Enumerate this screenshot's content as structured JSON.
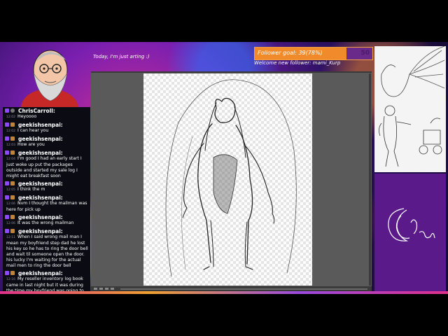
{
  "overlay": {
    "top_caption": "Today, I'm just arting :)",
    "follower_goal": "Follower goal: 39(78%)",
    "follower_goal_number": "50",
    "follower_goal_progress": 0.78,
    "welcome": "Welcome new follower: mami_Kurp"
  },
  "chat": {
    "messages": [
      {
        "user": "ChrisCarroll:",
        "time": "12:02",
        "text": "Heyoooo",
        "badges": [
          "twitch-icon",
          "mod-icon"
        ]
      },
      {
        "user": "geekishsenpai:",
        "time": "12:02",
        "text": "I can hear you",
        "badges": [
          "twitch-icon",
          "sub-icon"
        ]
      },
      {
        "user": "geekishsenpai:",
        "time": "12:03",
        "text": "How are you",
        "badges": [
          "twitch-icon",
          "sub-icon"
        ]
      },
      {
        "user": "geekishsenpai:",
        "time": "12:04",
        "text": "I'm good I had an early start I just woke up put the packages outside and started my sale log I might eat breakfast soon",
        "badges": [
          "twitch-icon",
          "sub-icon"
        ]
      },
      {
        "user": "geekishsenpai:",
        "time": "12:05",
        "text": "I think the m",
        "badges": [
          "twitch-icon",
          "sub-icon"
        ]
      },
      {
        "user": "geekishsenpai:",
        "time": "12:06",
        "text": "Nvm I thought the mailman was here for pick up",
        "badges": [
          "twitch-icon",
          "sub-icon"
        ]
      },
      {
        "user": "geekishsenpai:",
        "time": "12:06",
        "text": "It was the wrong mailman",
        "badges": [
          "twitch-icon",
          "sub-icon"
        ]
      },
      {
        "user": "geekishsenpai:",
        "time": "12:11",
        "text": "When I said wrong mail man I mean my boyfriend step dad he lost his key so he has to ring the door bell and wait til someone open the door. his lucky I'm waiting for the actual mail men to ring the door bell",
        "badges": [
          "twitch-icon",
          "sub-icon"
        ]
      },
      {
        "user": "geekishsenpai:",
        "time": "12:16",
        "text": "My reseller inventory log book came in last night but it was during the time my boyfriend was going to bed so I couldn't write it in til this morning",
        "badges": [
          "twitch-icon",
          "sub-icon"
        ]
      }
    ]
  },
  "colors": {
    "twitch": "#9146ff",
    "goal_fill": "#f08a2a",
    "panel_purple": "#5a1a8a"
  }
}
